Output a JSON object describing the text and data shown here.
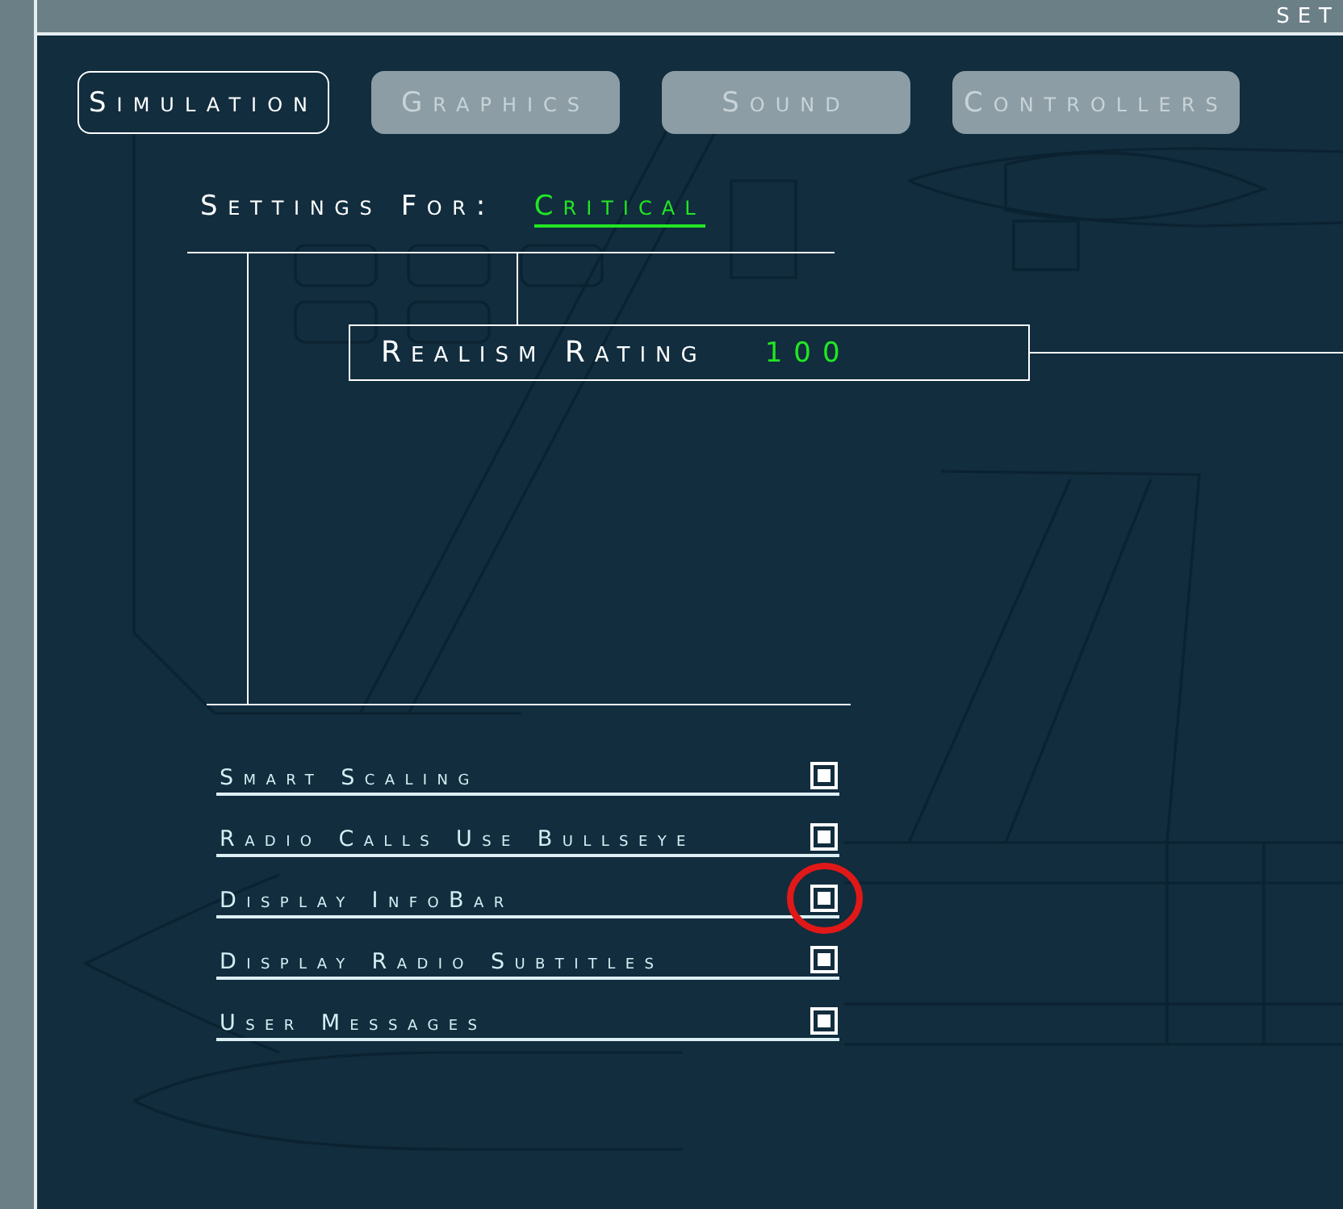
{
  "header": {
    "title": "SET"
  },
  "tabs": [
    {
      "label": "Simulation",
      "selected": true
    },
    {
      "label": "Graphics",
      "selected": false
    },
    {
      "label": "Sound",
      "selected": false
    },
    {
      "label": "Controllers",
      "selected": false
    }
  ],
  "settings_for": {
    "label": "Settings For:",
    "value": "Critical"
  },
  "realism_rating": {
    "label": "Realism Rating",
    "value": "100"
  },
  "options": [
    {
      "label": "Smart Scaling",
      "checked": true,
      "highlighted": false
    },
    {
      "label": "Radio Calls Use Bullseye",
      "checked": true,
      "highlighted": false
    },
    {
      "label": "Display InfoBar",
      "checked": true,
      "highlighted": true
    },
    {
      "label": "Display Radio Subtitles",
      "checked": true,
      "highlighted": false
    },
    {
      "label": "User Messages",
      "checked": true,
      "highlighted": false
    }
  ]
}
